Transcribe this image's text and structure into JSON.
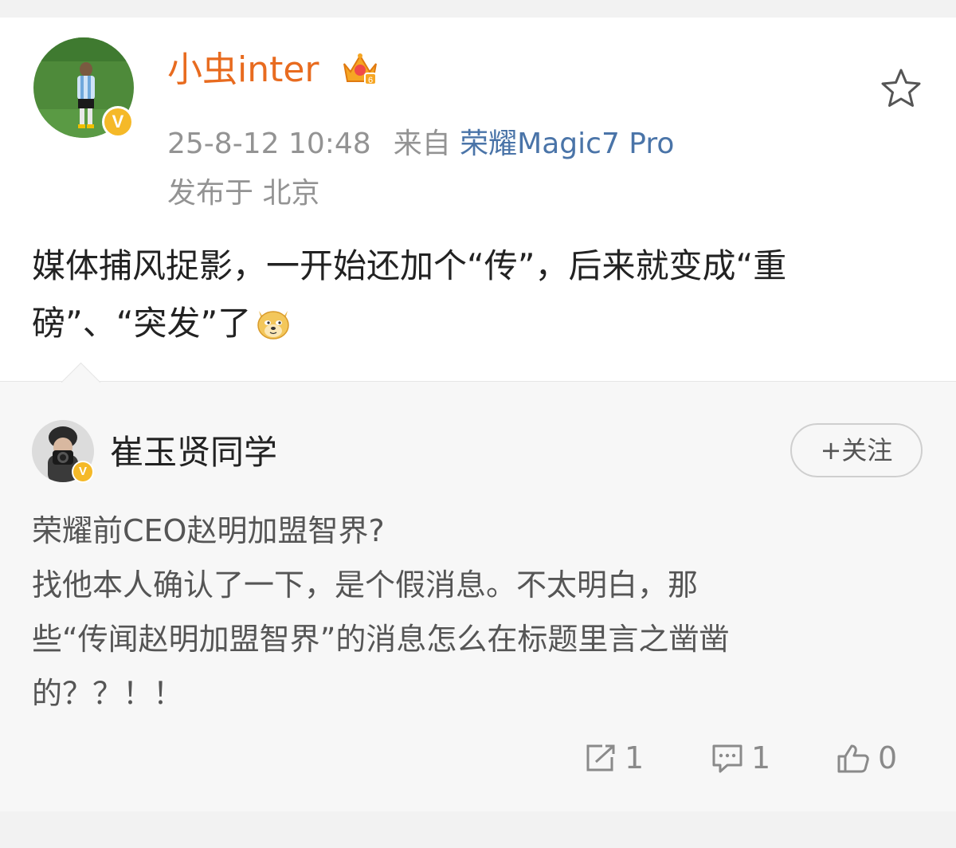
{
  "post": {
    "author": "小虫inter",
    "timestamp": "25-8-12 10:48",
    "source_label": "来自",
    "device": "荣耀Magic7 Pro",
    "location": "发布于 北京",
    "text_line1": "媒体捕风捉影，一开始还加个“传”，后来就变成“重",
    "text_line2": "磅”、“突发”了"
  },
  "repost": {
    "author": "崔玉贤同学",
    "follow_label": "+关注",
    "lines": [
      "荣耀前CEO赵明加盟智界?",
      "找他本人确认了一下，是个假消息。不太明白，那",
      "些“传闻赵明加盟智界”的消息怎么在标题里言之凿凿",
      "的？？！！"
    ]
  },
  "actions": {
    "share_count": "1",
    "comment_count": "1",
    "like_count": "0"
  },
  "icons": {
    "verified": "verified-v-badge",
    "vip": "crown-vip-icon",
    "favorite": "star-icon",
    "emoji": "doge-emoji",
    "share": "share-icon",
    "comment": "comment-icon",
    "like": "thumbs-up-icon"
  },
  "colors": {
    "author_orange": "#e86b1f",
    "device_blue": "#4a74a8",
    "verified_gold": "#f5b928"
  }
}
